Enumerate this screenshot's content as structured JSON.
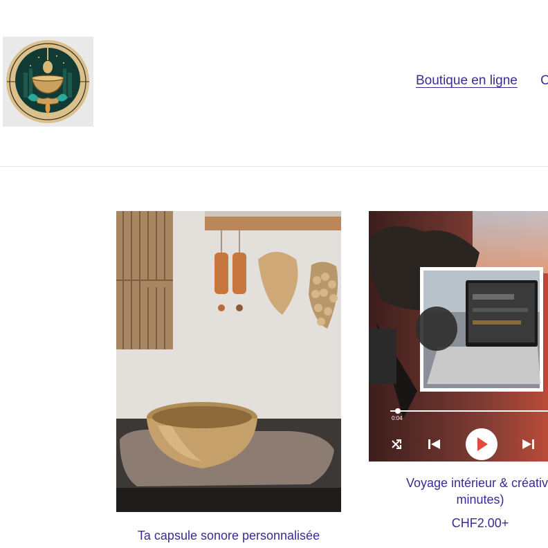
{
  "header": {
    "nav": [
      {
        "label": "Boutique en ligne"
      },
      {
        "label": "C"
      }
    ]
  },
  "products": [
    {
      "title": "Ta capsule sonore personnalisée"
    },
    {
      "title": "Voyage intérieur & créativit",
      "title_line2": "minutes)",
      "price": "CHF2.00+"
    }
  ],
  "player": {
    "time": "0:04"
  },
  "colors": {
    "accent": "#3d2a8f",
    "player_red": "#d8473a"
  }
}
